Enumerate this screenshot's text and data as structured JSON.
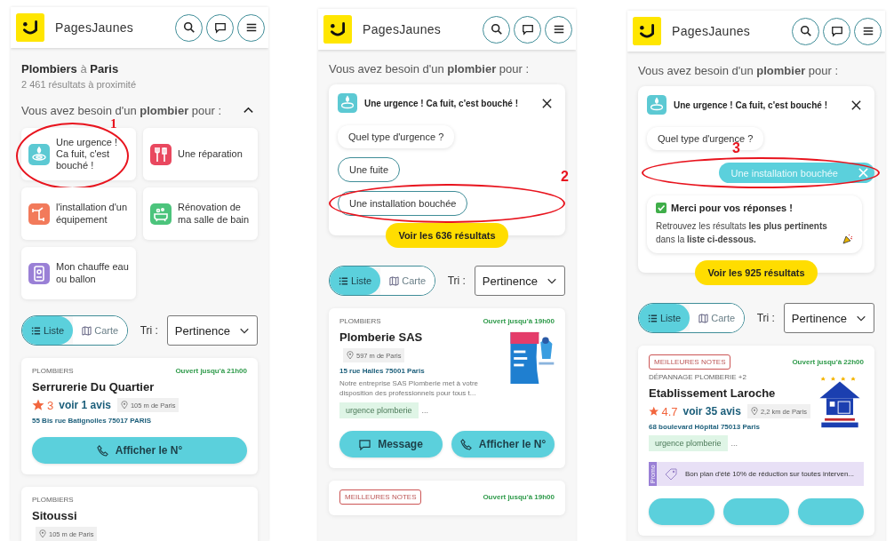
{
  "panels": [
    {
      "brand": "PagesJaunes",
      "header_buttons": [
        {
          "kind": "search"
        },
        {
          "kind": "chat"
        },
        {
          "kind": "menu"
        }
      ],
      "heading": "**Plombiers** à **Paris**",
      "count": "2 461 résultats à proximité",
      "question": {
        "text": "Vous avez besoin d'un **plombier** pour :",
        "expanded": true
      },
      "categories": [
        {
          "label": "Une urgence ! Ca fuit, c'est bouché !",
          "kind": "drop",
          "color": "#5cc9d3",
          "annotation": "1"
        },
        {
          "label": "Une réparation",
          "kind": "tools",
          "color": "#e9485f"
        },
        {
          "label": "l'installation d'un équipement",
          "kind": "pipe",
          "color": "#f27a5b"
        },
        {
          "label": "Rénovation de ma salle de bain",
          "kind": "bath",
          "color": "#4cc47c"
        },
        {
          "label": "Mon chauffe eau ou ballon",
          "kind": "boiler",
          "color": "#9a80d6"
        }
      ],
      "view": {
        "options": [
          {
            "label": "Liste",
            "kind": "list",
            "selected": true
          },
          {
            "label": "Carte",
            "kind": "map",
            "selected": false
          }
        ],
        "sort_label": "Tri :",
        "sort_value": "Pertinence"
      },
      "results": [
        {
          "category": "PLOMBIERS",
          "open": "Ouvert jusqu'à 21h00",
          "name": "Serrurerie Du Quartier",
          "rating": "3",
          "reviews": "voir 1 avis",
          "distance": "105 m de Paris",
          "address": "55 Bis rue Batignolles 75017 PARIS",
          "actions": [
            {
              "kind": "phone",
              "label": "Afficher le N°"
            }
          ]
        },
        {
          "category": "PLOMBIERS",
          "name": "Sitoussi",
          "distance": "105 m de Paris"
        }
      ]
    },
    {
      "brand": "PagesJaunes",
      "header_buttons": [
        {
          "kind": "search"
        },
        {
          "kind": "chat"
        },
        {
          "kind": "menu"
        }
      ],
      "question": {
        "text": "Vous avez besoin d'un **plombier** pour :"
      },
      "wizard": {
        "title": "Une urgence ! Ca fuit, c'est bouché !",
        "prompt": "Quel type d'urgence ?",
        "options": [
          {
            "label": "Une fuite",
            "selected": false
          },
          {
            "label": "Une installation bouchée",
            "selected": false,
            "annotation": "2"
          }
        ],
        "cta": "Voir les 636 résultats"
      },
      "view": {
        "options": [
          {
            "label": "Liste",
            "kind": "list",
            "selected": true
          },
          {
            "label": "Carte",
            "kind": "map",
            "selected": false
          }
        ],
        "sort_label": "Tri :",
        "sort_value": "Pertinence"
      },
      "results": [
        {
          "category": "PLOMBIERS",
          "open": "Ouvert jusqu'à 19h00",
          "name": "Plomberie SAS",
          "distance": "597 m de Paris",
          "address": "15 rue Halles 75001 Paris",
          "description": "Notre entreprise SAS Plomberie met à votre disposition des professionnels pour tous t...",
          "tags": [
            "urgence plomberie"
          ],
          "more": "...",
          "thumbnail": {
            "kind": "picture"
          },
          "actions": [
            {
              "kind": "message",
              "label": "Message"
            },
            {
              "kind": "phone",
              "label": "Afficher le N°"
            }
          ]
        },
        {
          "badge": "MEILLEURES NOTES",
          "open": "Ouvert jusqu'à 19h00"
        }
      ]
    },
    {
      "brand": "PagesJaunes",
      "header_buttons": [
        {
          "kind": "search"
        },
        {
          "kind": "chat"
        },
        {
          "kind": "menu"
        }
      ],
      "question": {
        "text": "Vous avez besoin d'un **plombier** pour :"
      },
      "wizard": {
        "title": "Une urgence ! Ca fuit, c'est bouché !",
        "prompt": "Quel type d'urgence ?",
        "answer": {
          "label": "Une installation bouchée",
          "annotation": "3"
        },
        "thanks": {
          "title": "Merci pour vos réponses !",
          "text": "Retrouvez les résultats **les plus pertinents** dans la **liste ci-dessous.**"
        },
        "cta": "Voir les 925 résultats"
      },
      "view": {
        "options": [
          {
            "label": "Liste",
            "kind": "list",
            "selected": true
          },
          {
            "label": "Carte",
            "kind": "map",
            "selected": false
          }
        ],
        "sort_label": "Tri :",
        "sort_value": "Pertinence"
      },
      "results": [
        {
          "badge": "MEILLEURES NOTES",
          "category": "DÉPANNAGE PLOMBERIE +2",
          "open": "Ouvert jusqu'à 22h00",
          "name": "Etablissement Laroche",
          "rating": "4.7",
          "reviews": "voir 35 avis",
          "distance": "2,2 km de Paris",
          "address": "68 boulevard Hôpital 75013 Paris",
          "tags": [
            "urgence plomberie"
          ],
          "more": "...",
          "thumbnail": {
            "kind": "picture"
          },
          "promo": {
            "label": "Promo",
            "text": "Bon plan d'été 10% de réduction sur toutes interven..."
          },
          "actions": [
            {
              "kind": "blank"
            },
            {
              "kind": "blank"
            },
            {
              "kind": "blank"
            }
          ]
        }
      ]
    }
  ]
}
